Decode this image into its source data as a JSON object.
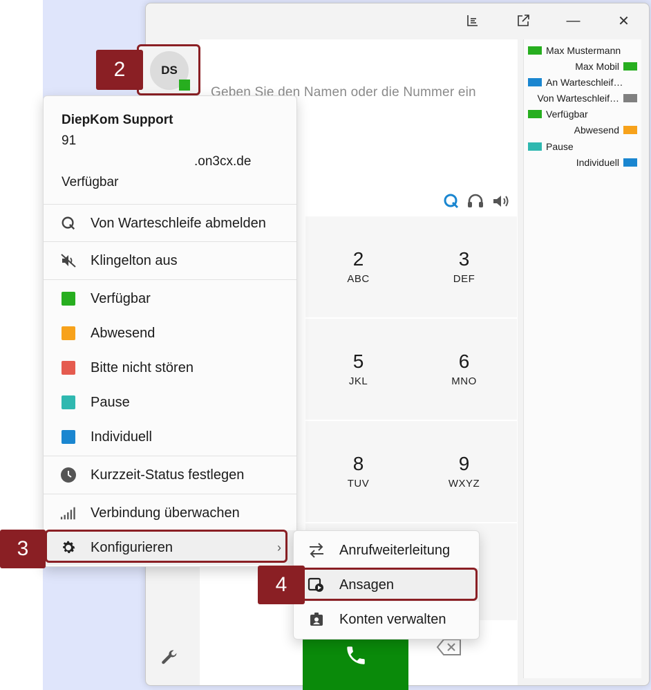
{
  "window": {
    "titlebar": {
      "layout_icon": "layout-icon",
      "popout_icon": "popout-icon",
      "minimize_label": "—",
      "close_label": "✕"
    },
    "dial": {
      "placeholder": "Geben Sie den Namen oder die Nummer ein"
    },
    "keypad": [
      {
        "num": "2",
        "letters": "ABC"
      },
      {
        "num": "3",
        "letters": "DEF"
      },
      {
        "num": "5",
        "letters": "JKL"
      },
      {
        "num": "6",
        "letters": "MNO"
      },
      {
        "num": "8",
        "letters": "TUV"
      },
      {
        "num": "9",
        "letters": "WXYZ"
      }
    ]
  },
  "legend": [
    {
      "label": "Max Mustermann",
      "color": "#27ae1f",
      "side": "left"
    },
    {
      "label": "Max Mobil",
      "color": "#27ae1f",
      "side": "right"
    },
    {
      "label": "An Warteschleif…",
      "color": "#1a86d0",
      "side": "left"
    },
    {
      "label": "Von Warteschleif…",
      "color": "#808080",
      "side": "right"
    },
    {
      "label": "Verfügbar",
      "color": "#27ae1f",
      "side": "left"
    },
    {
      "label": "Abwesend",
      "color": "#f7a21b",
      "side": "right"
    },
    {
      "label": "Pause",
      "color": "#2fb8b0",
      "side": "left"
    },
    {
      "label": "Individuell",
      "color": "#1a86d0",
      "side": "right"
    }
  ],
  "avatar": {
    "initials": "DS",
    "status_color": "#27ae1f"
  },
  "profile": {
    "name": "DiepKom Support",
    "extension": "91",
    "domain": ".on3cx.de",
    "status": "Verfügbar"
  },
  "menu": {
    "queue_logout": "Von Warteschleife abmelden",
    "ringtone_off": "Klingelton aus",
    "statuses": [
      {
        "label": "Verfügbar",
        "color": "#27ae1f"
      },
      {
        "label": "Abwesend",
        "color": "#f7a21b"
      },
      {
        "label": "Bitte nicht stören",
        "color": "#e55b4f"
      },
      {
        "label": "Pause",
        "color": "#2fb8b0"
      },
      {
        "label": "Individuell",
        "color": "#1a86d0"
      }
    ],
    "short_status": "Kurzzeit-Status festlegen",
    "monitor_connection": "Verbindung überwachen",
    "configure": "Konfigurieren",
    "configure_chevron": "›"
  },
  "submenu": {
    "forwarding": "Anrufweiterleitung",
    "announcements": "Ansagen",
    "manage_accounts": "Konten verwalten"
  },
  "callouts": {
    "step2": "2",
    "step3": "3",
    "step4": "4"
  }
}
